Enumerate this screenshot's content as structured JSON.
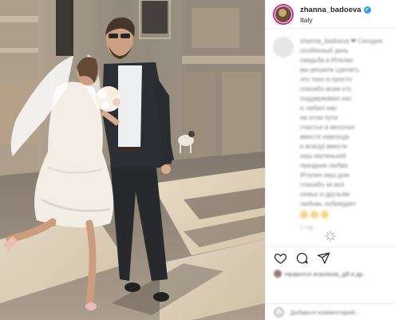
{
  "post": {
    "username": "zhanna_badoeva",
    "verified_mark": "✓",
    "location": "Italy",
    "avatar": "profile-avatar",
    "photo": "wedding-couple-photo",
    "caption_lines": [
      "zhanna_badoeva ❤ Сегодня",
      "особенный день",
      "свадьба в Италии",
      "мы решили сделать",
      "это тихо и просто",
      "спасибо всем кто",
      "поддерживал нас",
      "и любил нас",
      "на этом пути",
      "счастье в мелочах",
      "вместе навсегда",
      "и всегда вместе",
      "наш маленький",
      "праздник любви",
      "Италия наш дом",
      "спасибо за всё",
      "семье и друзьям",
      "любовь побеждает"
    ],
    "caption_time": "1 год",
    "likes_text": "Нравится anastasia_gill и др.",
    "comment_placeholder": "Добавьте комментарий..."
  },
  "icons": {
    "heart": "heart-icon",
    "comment": "comment-icon",
    "share": "share-icon",
    "loader": "loader-icon",
    "emoji": "emoji-icon"
  },
  "colors": {
    "verified": "#3897f0",
    "story_ring": "#d6249f",
    "text": "#262626",
    "divider": "#efefef"
  }
}
